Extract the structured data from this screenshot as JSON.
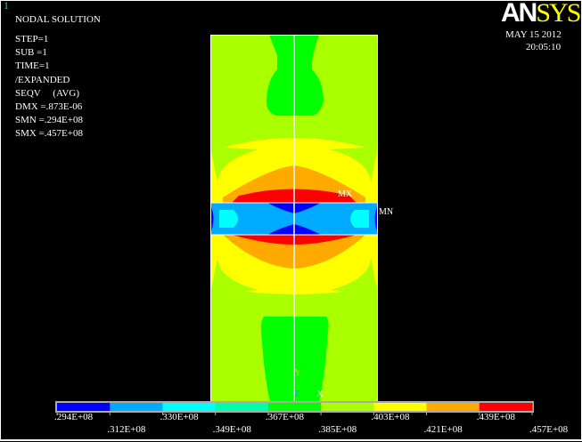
{
  "window_number": "1",
  "info": {
    "title": "NODAL SOLUTION",
    "lines": [
      "STEP=1",
      "SUB =1",
      "TIME=1",
      "/EXPANDED",
      "SEQV     (AVG)",
      "DMX =.873E-06",
      "SMN =.294E+08",
      "SMX =.457E+08"
    ]
  },
  "logo": {
    "part1": "AN",
    "part2": "SYS"
  },
  "date": "MAY 15 2012",
  "time": "20:05:10",
  "markers": {
    "max": "MX",
    "min": "MN",
    "axis_x": "X",
    "axis_y": "Y",
    "axis_z": "Z"
  },
  "chart_data": {
    "type": "heatmap",
    "title": "NODAL SOLUTION SEQV (AVG)",
    "min": 29400000.0,
    "max": 45700000.0,
    "levels": [
      ".294E+08",
      ".312E+08",
      ".330E+08",
      ".349E+08",
      ".367E+08",
      ".385E+08",
      ".403E+08",
      ".421E+08",
      ".439E+08",
      ".457E+08"
    ],
    "colors": [
      "#0000ff",
      "#00aaff",
      "#00ffff",
      "#00ffaa",
      "#00ff00",
      "#aaff00",
      "#ffff00",
      "#ffaa00",
      "#ff0000"
    ],
    "legend_placement": "bottom"
  }
}
